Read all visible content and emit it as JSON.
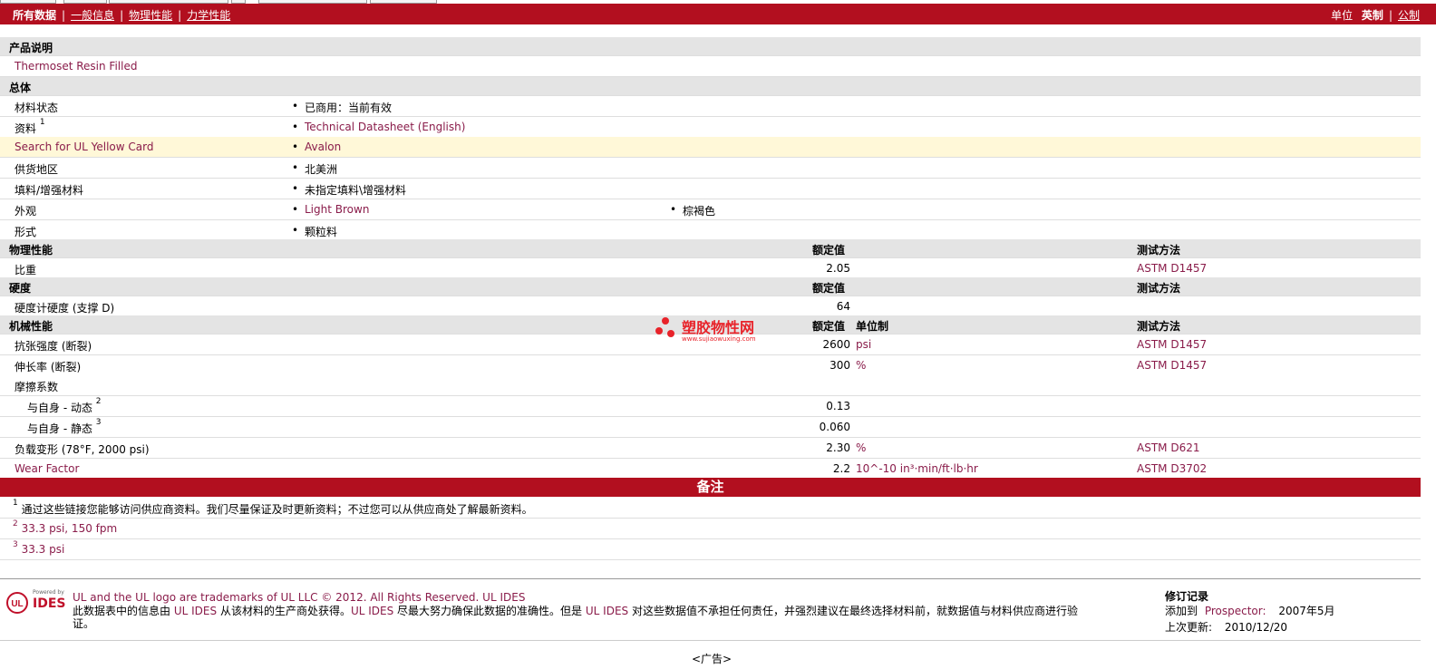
{
  "nav": {
    "items": [
      "所有数据",
      "一般信息",
      "物理性能",
      "力学性能"
    ],
    "units_label": "单位",
    "units": [
      "英制",
      "公制"
    ]
  },
  "product": {
    "header": "产品说明",
    "description": "Thermoset Resin Filled"
  },
  "general": {
    "header": "总体",
    "rows": [
      {
        "label": "材料状态",
        "value": "已商用：当前有效"
      },
      {
        "label": "资料",
        "sup": "1",
        "value": "Technical Datasheet (English)"
      },
      {
        "label": "Search for UL Yellow Card",
        "value": "Avalon"
      },
      {
        "label": "供货地区",
        "value": "北美洲"
      },
      {
        "label": "填料/增强材料",
        "value": "未指定填料\\增强材料"
      },
      {
        "label": "外观",
        "value": "Light Brown",
        "value2": "棕褐色"
      },
      {
        "label": "形式",
        "value": "颗粒料"
      }
    ]
  },
  "physical": {
    "header": "物理性能",
    "col_nominal": "额定值",
    "col_method": "测试方法",
    "rows": [
      {
        "label": "比重",
        "value": "2.05",
        "method": "ASTM D1457"
      }
    ]
  },
  "hardness": {
    "header": "硬度",
    "col_nominal": "额定值",
    "col_method": "测试方法",
    "rows": [
      {
        "label": "硬度计硬度 (支撑 D)",
        "value": "64"
      }
    ]
  },
  "mechanical": {
    "header": "机械性能",
    "col_nominal": "额定值",
    "col_unit": "单位制",
    "col_method": "测试方法",
    "rows": [
      {
        "label": "抗张强度 (断裂)",
        "value": "2600",
        "unit": "psi",
        "method": "ASTM D1457"
      },
      {
        "label": "伸长率 (断裂)",
        "value": "300",
        "unit": "%",
        "method": "ASTM D1457"
      },
      {
        "label": "摩擦系数"
      },
      {
        "label": "与自身 - 动态",
        "sup": "2",
        "value": "0.13"
      },
      {
        "label": "与自身 - 静态",
        "sup": "3",
        "value": "0.060"
      },
      {
        "label": "负载变形 (78°F, 2000 psi)",
        "value": "2.30",
        "unit": "%",
        "method": "ASTM D621"
      },
      {
        "label": "Wear Factor",
        "value": "2.2",
        "unit": "10^-10 in³·min/ft·lb·hr",
        "method": "ASTM D3702"
      }
    ]
  },
  "notes": {
    "header": "备注",
    "items": [
      {
        "n": "1",
        "text": "通过这些链接您能够访问供应商资料。我们尽量保证及时更新资料；不过您可以从供应商处了解最新资料。"
      },
      {
        "n": "2",
        "text": "33.3 psi, 150 fpm"
      },
      {
        "n": "3",
        "text": "33.3 psi"
      }
    ]
  },
  "watermark": {
    "title": "塑胶物性网",
    "url": "www.sujiaowuxing.com"
  },
  "footer": {
    "logo_powered": "Powered by",
    "logo_text": "IDES",
    "trademark": "UL and the UL logo are trademarks of UL LLC © 2012. All Rights Reserved. UL IDES",
    "disclaimer_1": "此数据表中的信息由",
    "disclaimer_ul1": "UL IDES",
    "disclaimer_2": "从该材料的生产商处获得。",
    "disclaimer_ul2": "UL IDES",
    "disclaimer_3": "尽最大努力确保此数据的准确性。但是",
    "disclaimer_ul3": "UL IDES",
    "disclaimer_4": "对这些数据值不承担任何责任，并强烈建议在最终选择材料前，就数据值与材料供应商进行验",
    "disclaimer_5": "证。",
    "revision_title": "修订记录",
    "added_label": "添加到",
    "added_place": "Prospector:",
    "added_date": "2007年5月",
    "updated_label": "上次更新:",
    "updated_date": "2010/12/20",
    "ad": "<广告>"
  }
}
